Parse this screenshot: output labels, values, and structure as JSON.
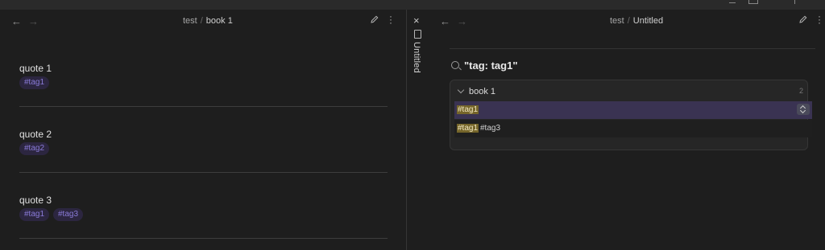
{
  "left_pane": {
    "nav_back": "←",
    "nav_forward": "→",
    "breadcrumb_parent": "test",
    "breadcrumb_sep": "/",
    "breadcrumb_current": "book 1",
    "edit_icon": "pencil-icon",
    "more_icon": "more-vertical-icon",
    "quotes": [
      {
        "text": "quote 1",
        "tags": [
          "#tag1"
        ]
      },
      {
        "text": "quote 2",
        "tags": [
          "#tag2"
        ]
      },
      {
        "text": "quote 3",
        "tags": [
          "#tag1",
          "#tag3"
        ]
      }
    ]
  },
  "vertical_tab": {
    "close": "×",
    "label": "Untitled",
    "icon": "file-icon"
  },
  "right_pane": {
    "nav_back": "←",
    "nav_forward": "→",
    "breadcrumb_parent": "test",
    "breadcrumb_sep": "/",
    "breadcrumb_current": "Untitled",
    "search_query": "\"tag: tag1\"",
    "results": {
      "group_title": "book 1",
      "group_count": "2",
      "matches": [
        {
          "highlight": "#tag1",
          "rest": ""
        },
        {
          "highlight": "#tag1",
          "rest": "#tag3"
        }
      ]
    }
  },
  "colors": {
    "background": "#1e1e1e",
    "tag_text": "#8a7bd8",
    "tag_bg": "#2c2640",
    "highlight_bg": "#75652a",
    "selected_row": "#3a3352"
  }
}
